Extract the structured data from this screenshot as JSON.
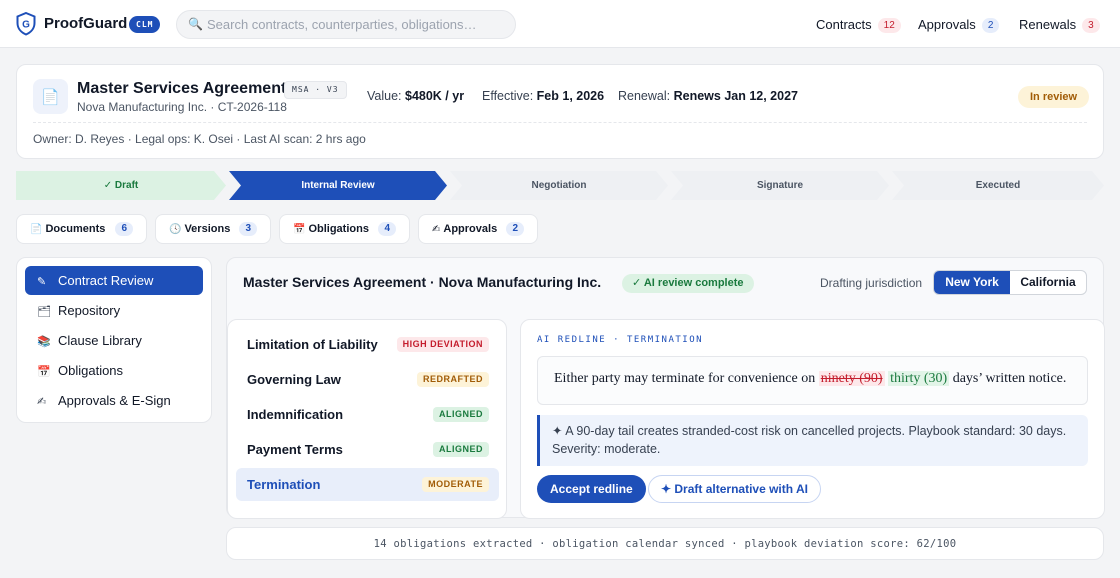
{
  "app": {
    "brand": "ProofGuard",
    "brand_tag": "CLM",
    "search_placeholder": "Search contracts, counterparties, obligations…"
  },
  "nav": [
    {
      "label": "Contracts",
      "count": "12",
      "color": "#c41d2d"
    },
    {
      "label": "Approvals",
      "count": "2",
      "color": "#1e4fb8"
    },
    {
      "label": "Renewals",
      "count": "3",
      "color": "#c41d2d"
    }
  ],
  "contract": {
    "title": "Master Services Agreement",
    "version_badge": "MSA · V3",
    "subtitle": "Nova Manufacturing Inc. · CT-2026-118",
    "value_label": "Value:",
    "value": "$480K / yr",
    "effective_label": "Effective:",
    "effective": "Feb 1, 2026",
    "renewal_label": "Renewal:",
    "renewal": "Renews Jan 12, 2027",
    "status": "In review",
    "owner_line": "Owner: D. Reyes · Legal ops: K. Osei · Last AI scan: 2 hrs ago"
  },
  "stepper": [
    {
      "label": "✓ Draft",
      "state": "done"
    },
    {
      "label": "Internal Review",
      "state": "active"
    },
    {
      "label": "Negotiation",
      "state": "todo"
    },
    {
      "label": "Signature",
      "state": "todo"
    },
    {
      "label": "Executed",
      "state": "todo"
    }
  ],
  "tabs": [
    {
      "icon": "📄",
      "label": "Documents",
      "count": "6"
    },
    {
      "icon": "🕓",
      "label": "Versions",
      "count": "3"
    },
    {
      "icon": "📅",
      "label": "Obligations",
      "count": "4"
    },
    {
      "icon": "✍",
      "label": "Approvals",
      "count": "2"
    }
  ],
  "sidebar": [
    {
      "icon": "✎",
      "label": "Contract Review",
      "active": true
    },
    {
      "icon": "🗂",
      "label": "Repository"
    },
    {
      "icon": "📚",
      "label": "Clause Library"
    },
    {
      "icon": "📅",
      "label": "Obligations"
    },
    {
      "icon": "✍",
      "label": "Approvals & E-Sign"
    }
  ],
  "main": {
    "title": "Master Services Agreement · Nova Manufacturing Inc.",
    "ai_status": "✓ AI review complete",
    "jurisdiction_label": "Drafting jurisdiction",
    "jurisdiction_options": [
      "New York",
      "California"
    ],
    "jurisdiction_selected": "New York"
  },
  "clauses": [
    {
      "name": "Limitation of Liability",
      "badge": "HIGH DEVIATION",
      "level": "high"
    },
    {
      "name": "Governing Law",
      "badge": "REDRAFTED",
      "level": "redr"
    },
    {
      "name": "Indemnification",
      "badge": "ALIGNED",
      "level": "alig"
    },
    {
      "name": "Payment Terms",
      "badge": "ALIGNED",
      "level": "alig"
    },
    {
      "name": "Termination",
      "badge": "MODERATE",
      "level": "mod",
      "active": true
    }
  ],
  "redline": {
    "heading": "AI REDLINE · TERMINATION",
    "text_before": "Either party may terminate for convenience on",
    "deleted": "ninety (90)",
    "inserted": "thirty (30)",
    "text_after": "days’ written notice.",
    "note": "✦ A 90-day tail creates stranded-cost risk on cancelled projects. Playbook standard: 30 days. Severity: moderate.",
    "accept_label": "Accept redline",
    "draft_label": "✦ Draft alternative with AI"
  },
  "footer": "14 obligations extracted · obligation calendar synced · playbook deviation score: 62/100",
  "colors": {
    "accent": "#1e4fb8",
    "success": "#1a7a3e",
    "danger": "#c41d2d",
    "warning": "#a15c07"
  }
}
